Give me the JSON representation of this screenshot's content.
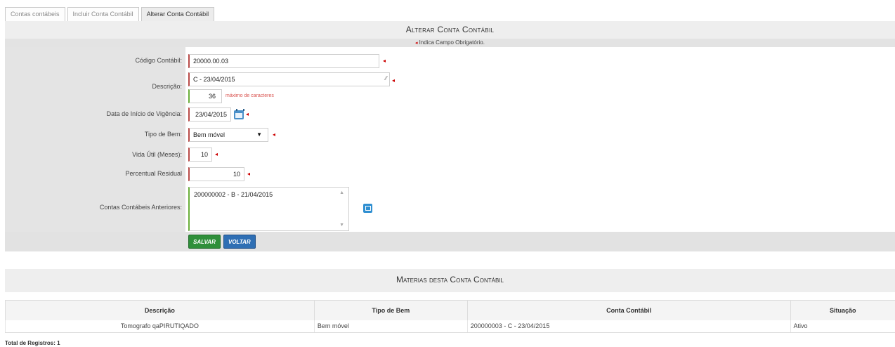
{
  "tabs": [
    {
      "label": "Contas contábeis"
    },
    {
      "label": "Incluir Conta Contábil"
    },
    {
      "label": "Alterar Conta Contábil"
    }
  ],
  "form": {
    "title": "Alterar Conta Contábil",
    "required_note": "Indica Campo Obrigatório.",
    "fields": {
      "codigo": {
        "label": "Código Contábil:",
        "value": "20000.00.03"
      },
      "descricao": {
        "label": "Descrição:",
        "value": "C - 23/04/2015",
        "counter": "36",
        "counter_text": "máximo de caracteres"
      },
      "data_inicio": {
        "label": "Data de Início de Vigência:",
        "value": "23/04/2015"
      },
      "tipo_bem": {
        "label": "Tipo de Bem:",
        "value": "Bem móvel"
      },
      "vida_util": {
        "label": "Vida Útil (Meses):",
        "value": "10"
      },
      "percentual": {
        "label": "Percentual Residual",
        "value": "10"
      },
      "contas_anteriores": {
        "label": "Contas Contábeis Anteriores:",
        "value": "200000002 - B - 21/04/2015"
      }
    },
    "buttons": {
      "salvar": "SALVAR",
      "voltar": "VOLTAR"
    }
  },
  "materias": {
    "title": "Materias desta Conta Contábil",
    "columns": [
      "Descrição",
      "Tipo de Bem",
      "Conta Contábil",
      "Situação"
    ],
    "rows": [
      {
        "descricao": "Tomografo qaPIRUTIQADO",
        "tipo_bem": "Bem móvel",
        "conta": "200000003 - C - 23/04/2015",
        "situacao": "Ativo"
      }
    ],
    "total": "Total de Registros: 1"
  },
  "colors": {
    "required": "#cc0000",
    "salvar": "#2f8f3a",
    "voltar": "#2f6fb4",
    "panel": "#eeeeee"
  },
  "icons": [
    "calendar-icon",
    "popup-icon",
    "select-arrow-icon",
    "resize-grip-icon"
  ]
}
